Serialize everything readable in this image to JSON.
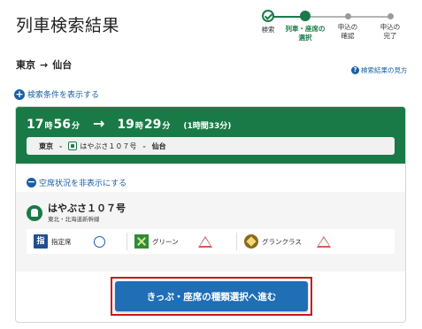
{
  "page": {
    "title": "列車検索結果"
  },
  "stepper": {
    "steps": [
      {
        "label_line1": "検索",
        "label_line2": "",
        "state": "done"
      },
      {
        "label_line1": "列車・座席の",
        "label_line2": "選択",
        "state": "current"
      },
      {
        "label_line1": "申込の",
        "label_line2": "確認",
        "state": "todo"
      },
      {
        "label_line1": "申込の",
        "label_line2": "完了",
        "state": "todo"
      }
    ]
  },
  "route": {
    "from": "東京",
    "arrow": "→",
    "to": "仙台"
  },
  "help_link": {
    "icon": "question-icon",
    "label": "検索結果の見方"
  },
  "conditions_link": {
    "icon": "plus-circle-icon",
    "label": "検索条件を表示する"
  },
  "train_card": {
    "departure_hour": "17",
    "departure_minute": "56",
    "arrival_hour": "19",
    "arrival_minute": "29",
    "hour_unit": "時",
    "minute_unit": "分",
    "arrow": "→",
    "duration": "(1時間33分)",
    "route_from": "東京",
    "route_train": "はやぶさ１０７号",
    "route_to": "仙台",
    "route_sep": "-",
    "seat_toggle_label": "空席状況を非表示にする",
    "train_name": "はやぶさ１０７号",
    "train_line": "東北・北海道新幹線",
    "seat_classes": [
      {
        "icon": "reserved-seat-icon",
        "icon_text": "指",
        "label": "指定席",
        "availability": "circle"
      },
      {
        "icon": "green-car-icon",
        "icon_text": "",
        "label": "グリーン",
        "availability": "triangle"
      },
      {
        "icon": "gran-class-icon",
        "icon_text": "",
        "label": "グランクラス",
        "availability": "triangle"
      }
    ]
  },
  "proceed_button": {
    "label": "きっぷ・座席の種類選択へ進む"
  },
  "colors": {
    "brand_green": "#1a7a47",
    "link_blue": "#1a5fa6",
    "button_blue": "#1f6eb6",
    "highlight_red": "#c8171e",
    "triangle_red": "#d65a5a"
  }
}
